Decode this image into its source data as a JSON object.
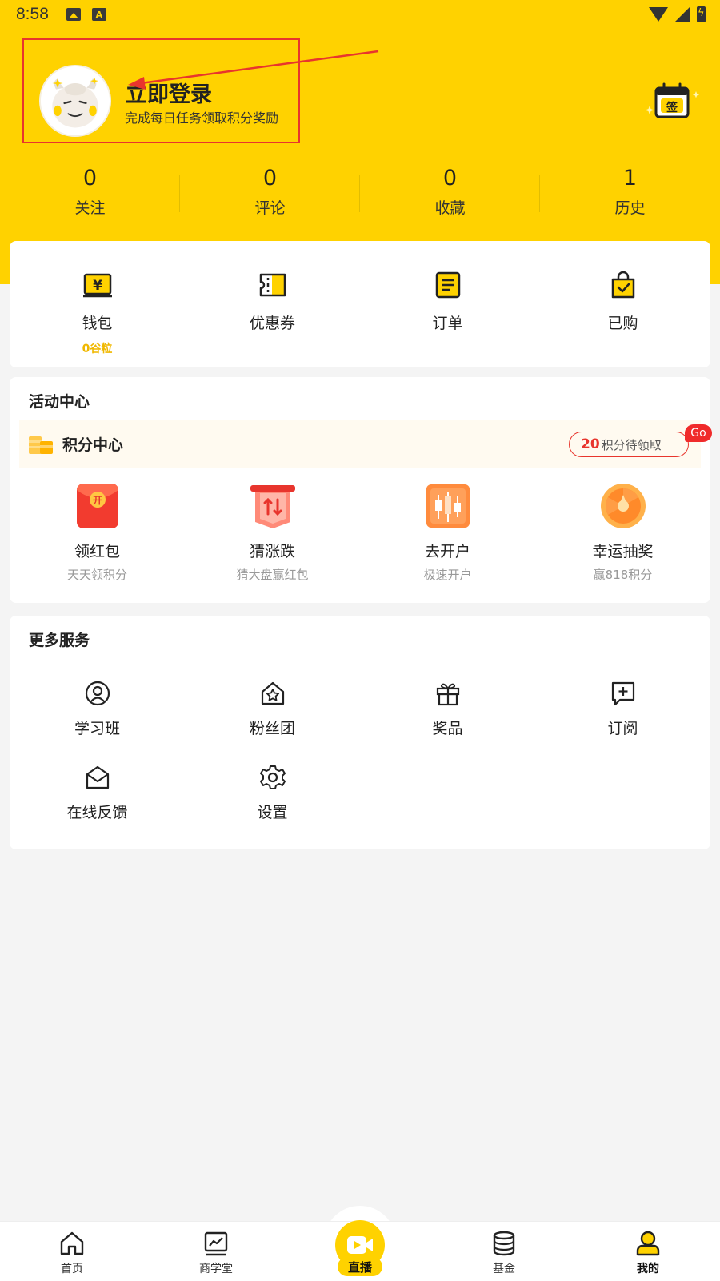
{
  "status_bar": {
    "time": "8:58"
  },
  "profile": {
    "login_title": "立即登录",
    "login_subtitle": "完成每日任务领取积分奖励",
    "checkin_label": "签"
  },
  "stats": [
    {
      "value": "0",
      "label": "关注"
    },
    {
      "value": "0",
      "label": "评论"
    },
    {
      "value": "0",
      "label": "收藏"
    },
    {
      "value": "1",
      "label": "历史"
    }
  ],
  "account": {
    "wallet": {
      "label": "钱包",
      "sub": "0谷粒",
      "icon": "wallet-icon"
    },
    "coupon": {
      "label": "优惠券",
      "icon": "coupon-icon"
    },
    "orders": {
      "label": "订单",
      "icon": "order-icon"
    },
    "purchased": {
      "label": "已购",
      "icon": "purchased-bag-icon"
    }
  },
  "activity": {
    "title": "活动中心",
    "points_center": {
      "title": "积分中心",
      "pending_count": "20",
      "pending_text": "积分待领取",
      "go_label": "Go"
    },
    "items": [
      {
        "label": "领红包",
        "sub": "天天领积分",
        "icon": "red-envelope-icon"
      },
      {
        "label": "猜涨跌",
        "sub": "猜大盘赢红包",
        "icon": "guess-trend-icon"
      },
      {
        "label": "去开户",
        "sub": "极速开户",
        "icon": "candlestick-icon"
      },
      {
        "label": "幸运抽奖",
        "sub": "赢818积分",
        "icon": "lucky-wheel-icon"
      }
    ]
  },
  "services": {
    "title": "更多服务",
    "items": [
      {
        "label": "学习班",
        "icon": "user-circle-icon"
      },
      {
        "label": "粉丝团",
        "icon": "fan-house-icon"
      },
      {
        "label": "奖品",
        "icon": "gift-icon"
      },
      {
        "label": "订阅",
        "icon": "subscribe-icon"
      },
      {
        "label": "在线反馈",
        "icon": "mail-open-icon"
      },
      {
        "label": "设置",
        "icon": "gear-icon"
      }
    ]
  },
  "bottom_nav": [
    {
      "label": "首页",
      "icon": "home-icon"
    },
    {
      "label": "商学堂",
      "icon": "chart-board-icon"
    },
    {
      "label": "直播",
      "icon": "video-camera-icon"
    },
    {
      "label": "基金",
      "icon": "database-icon"
    },
    {
      "label": "我的",
      "icon": "person-icon",
      "active": true
    }
  ],
  "colors": {
    "brand_yellow": "#ffd200",
    "accent_red": "#e8352d",
    "background": "#f4f4f4"
  }
}
